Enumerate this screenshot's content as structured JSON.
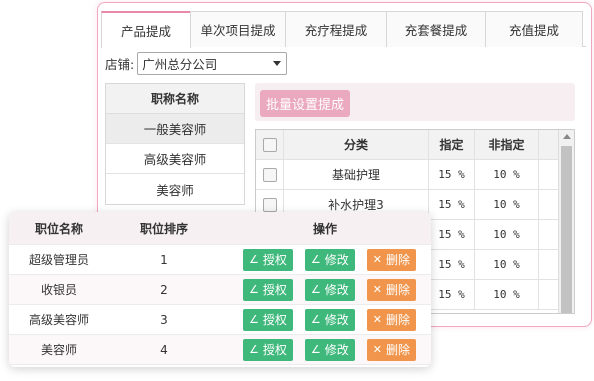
{
  "tabs": [
    "产品提成",
    "单次项目提成",
    "充疗程提成",
    "充套餐提成",
    "充值提成"
  ],
  "store": {
    "label": "店铺:",
    "value": "广州总分公司"
  },
  "titles": {
    "header": "职称名称",
    "items": [
      "一般美容师",
      "高级美容师",
      "美容师"
    ]
  },
  "batch_button": "批量设置提成",
  "grid": {
    "headers": [
      "分类",
      "指定",
      "非指定"
    ],
    "rows": [
      [
        "基础护理",
        "15 %",
        "10 %"
      ],
      [
        "补水护理3",
        "15 %",
        "10 %"
      ],
      [
        "",
        "15 %",
        "10 %"
      ],
      [
        "",
        "15 %",
        "10 %"
      ],
      [
        "",
        "15 %",
        "10 %"
      ]
    ]
  },
  "positions": {
    "headers": [
      "职位名称",
      "职位排序",
      "操作"
    ],
    "rows": [
      {
        "name": "超级管理员",
        "order": "1"
      },
      {
        "name": "收银员",
        "order": "2"
      },
      {
        "name": "高级美容师",
        "order": "3"
      },
      {
        "name": "美容师",
        "order": "4"
      }
    ],
    "actions": {
      "auth": "授权",
      "edit": "修改",
      "delete": "删除"
    }
  },
  "colors": {
    "accent_pink": "#e889a8",
    "green": "#3fb87c",
    "orange": "#f0954b"
  }
}
